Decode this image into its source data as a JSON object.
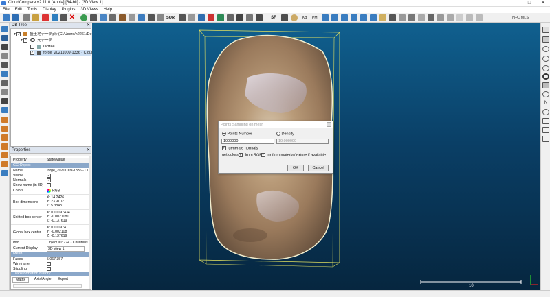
{
  "window": {
    "title": "CloudCompare v2.11.0 [Anoia] [64-bit] - [3D View 1]",
    "minimize": "–",
    "maximize": "□",
    "close": "✕"
  },
  "menu": [
    "File",
    "Edit",
    "Tools",
    "Display",
    "Plugins",
    "3D Views",
    "Help"
  ],
  "toolbar": {
    "sor_label": "SOR",
    "sf_label": "SF",
    "ncmls_label": "N+C MLS",
    "kd_label": "Kd",
    "pm_label": "PM"
  },
  "db_tree": {
    "title": "DB Tree",
    "items": [
      {
        "label": "盛土地データply (C:/Users/h2261/De···"
      },
      {
        "label": "元データ"
      },
      {
        "label": "Octree"
      },
      {
        "label": "forge_20211009-1336 - Cloun···"
      }
    ]
  },
  "properties": {
    "title": "Properties",
    "header": {
      "property": "Property",
      "value": "State/Value"
    },
    "section_cc": "CC Object",
    "rows_cc": [
      {
        "k": "Name",
        "v": "forge_20211009-1336 - Cl"
      },
      {
        "k": "Visible",
        "v": ""
      },
      {
        "k": "Normals",
        "v": ""
      },
      {
        "k": "Show name (in 3D)",
        "v": ""
      },
      {
        "k": "Colors",
        "v": "RGB"
      },
      {
        "k": "Box dimensions",
        "v": "X: 14.2426\nY: 23.9102\nZ: 5.38481"
      },
      {
        "k": "Shifted box center",
        "v": "X: 0.00197434\nY: -0.0021081\nZ: -0.137619"
      },
      {
        "k": "Global box center",
        "v": "X: 0.001974\nY: -0.002108\nZ: -0.137619"
      },
      {
        "k": "Info",
        "v": "Object ID: 274 - Childrens"
      },
      {
        "k": "Current Display",
        "v": "3D View 1"
      }
    ],
    "section_mesh": "Mesh",
    "rows_mesh": [
      {
        "k": "Faces",
        "v": "5,067,357"
      },
      {
        "k": "Wireframe",
        "v": ""
      },
      {
        "k": "Stippling",
        "v": ""
      }
    ],
    "section_transform": "Transformation history",
    "tabs": [
      "Matrix",
      "Axis/Angle",
      "Export"
    ]
  },
  "dialog": {
    "title": "Points Sampling on mesh",
    "points_number_label": "Points Number",
    "density_label": "Density",
    "points_value": "1000000",
    "density_value": "10.000000",
    "generate_normals_label": "generate normals",
    "get_colors_label": "get colors",
    "from_rgb_label": "from RGB",
    "from_material_label": "or from material/texture if available",
    "ok_label": "OK",
    "cancel_label": "Cancel"
  },
  "scale_bar_label": "10"
}
